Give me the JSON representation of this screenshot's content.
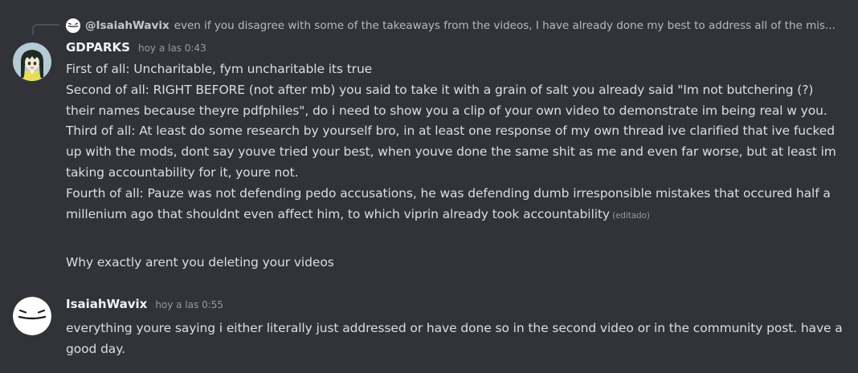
{
  "reply": {
    "username": "@IsaiahWavix",
    "text": "even if you disagree with some of the takeaways from the videos, I have already done my best to address all of the mis...",
    "avatar_icon": "white-blob-face-icon"
  },
  "messages": [
    {
      "username": "GDPARKS",
      "timestamp": "hoy a las 0:43",
      "avatar_icon": "anime-girl-avatar",
      "paragraphs": [
        "First of all: Uncharitable, fym uncharitable its true",
        "Second of all: RIGHT BEFORE (not after mb) you said to take it with a grain of salt you already said \"Im not butchering (?) their names because theyre pdfphiles\", do i need to show you a clip of your own video to demonstrate im being real w you.",
        "Third of all: At least do some research by yourself bro, in at least one response of my own thread ive clarified that ive fucked up with the mods, dont say youve tried your best, when youve done the same shit as me and even far worse, but at least im taking accountability for it, youre not.",
        "Fourth of all: Pauze was not defending pedo accusations, he was defending dumb irresponsible mistakes that occured half a millenium ago that shouldnt even affect him, to which viprin already took accountability"
      ],
      "edited_label": "(editado)",
      "followup": "Why exactly arent you deleting your videos"
    },
    {
      "username": "IsaiahWavix",
      "timestamp": "hoy a las 0:55",
      "avatar_icon": "white-blob-face-icon",
      "text": "everything youre saying i either literally just addressed or have done so in the second video or in the community post. have a good day."
    }
  ],
  "colors": {
    "background": "#313338",
    "text": "#dbdee1",
    "muted": "#949ba4",
    "username": "#f2f3f5"
  }
}
